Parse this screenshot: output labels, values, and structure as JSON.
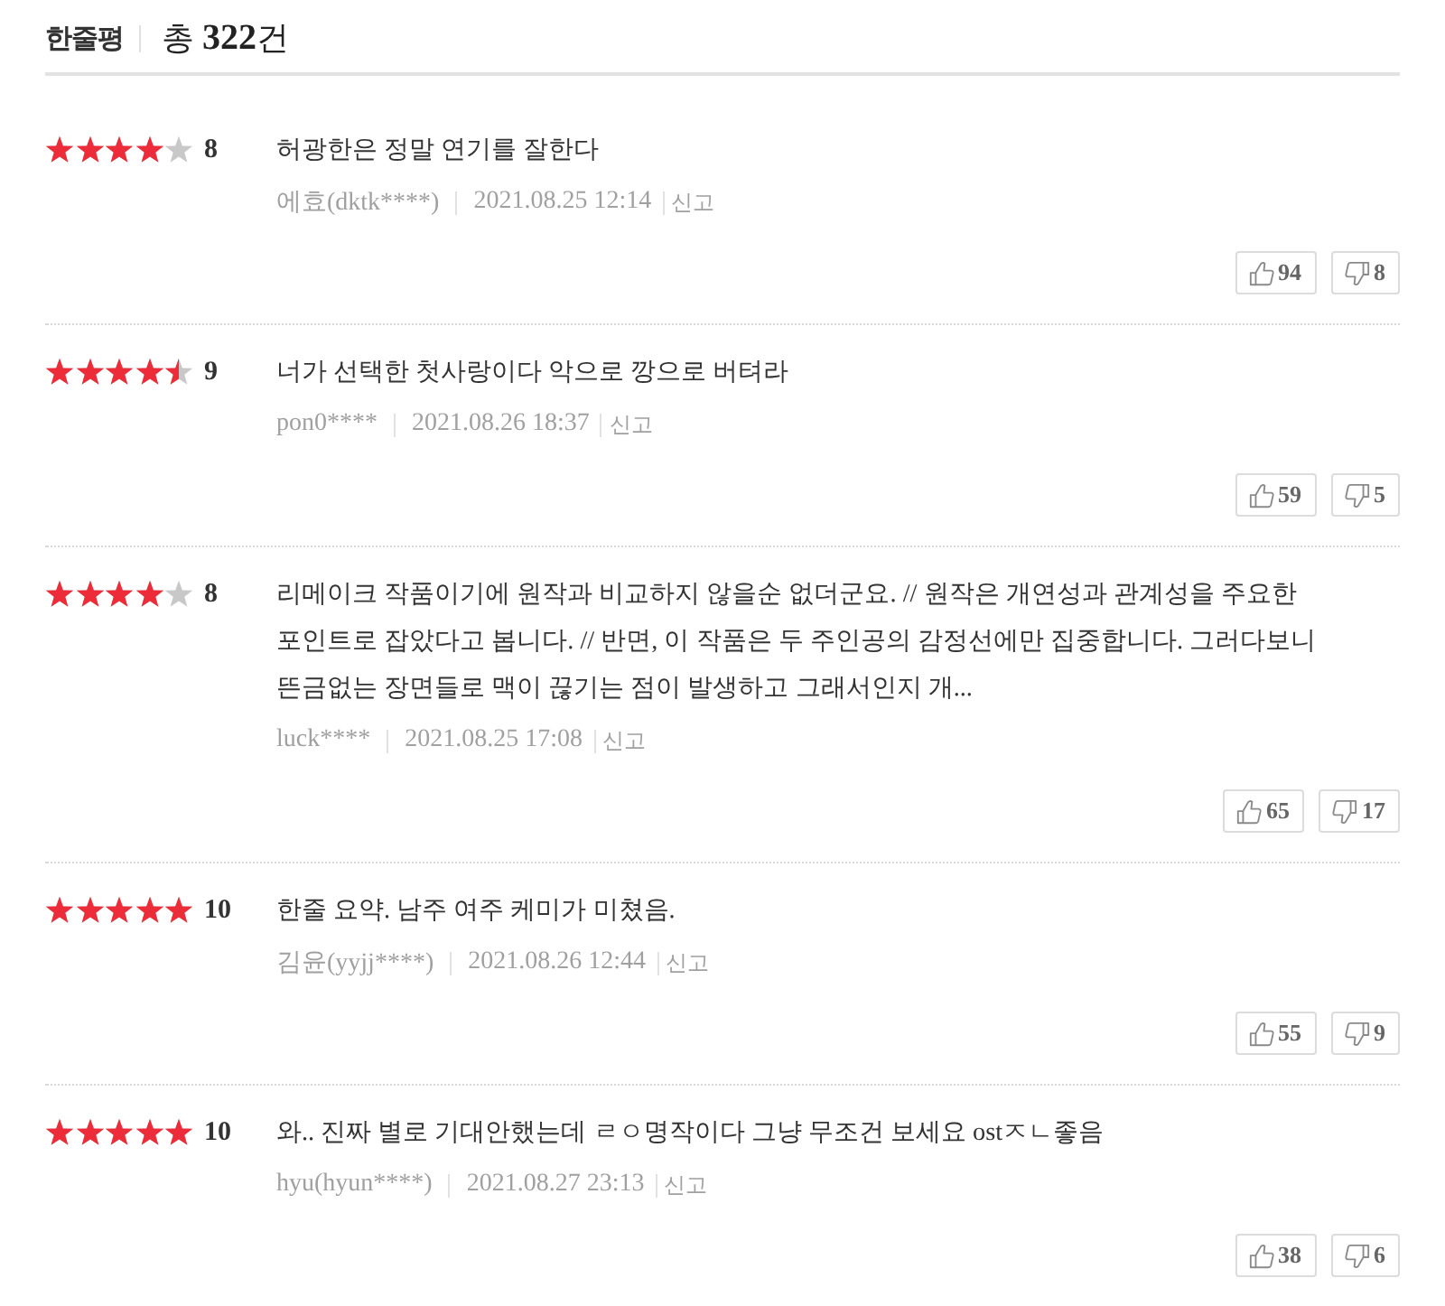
{
  "header": {
    "title": "한줄평",
    "total": "총 **322**건"
  },
  "reviews": [
    {
      "stars": 4,
      "score": "8",
      "text": "허광한은 정말 연기를 잘한다",
      "author": "에효(dktk****)",
      "date": "2021.08.25 12:14",
      "report": "신고",
      "likes": "94",
      "dislikes": "8"
    },
    {
      "stars": 4.5,
      "score": "9",
      "text": "너가 선택한 첫사랑이다 악으로 깡으로 버텨라",
      "author": "pon0****",
      "date": "2021.08.26 18:37",
      "report": "신고",
      "likes": "59",
      "dislikes": "5"
    },
    {
      "stars": 4,
      "score": "8",
      "text": "리메이크 작품이기에 원작과 비교하지 않을순 없더군요. // 원작은 개연성과 관계성을 주요한 포인트로 잡았다고 봅니다. // 반면, 이 작품은 두 주인공의 감정선에만 집중합니다. 그러다보니 뜬금없는 장면들로 맥이 끊기는 점이 발생하고 그래서인지 개...",
      "author": "luck****",
      "date": "2021.08.25 17:08",
      "report": "신고",
      "likes": "65",
      "dislikes": "17"
    },
    {
      "stars": 5,
      "score": "10",
      "text": "한줄 요약. 남주 여주 케미가 미쳤음.",
      "author": "김윤(yyjj****)",
      "date": "2021.08.26 12:44",
      "report": "신고",
      "likes": "55",
      "dislikes": "9"
    },
    {
      "stars": 5,
      "score": "10",
      "text": "와.. 진짜 별로 기대안했는데 ㄹㅇ명작이다 그냥 무조건 보세요 ostㅈㄴ좋음",
      "author": "hyu(hyun****)",
      "date": "2021.08.27 23:13",
      "report": "신고",
      "likes": "38",
      "dislikes": "6"
    }
  ]
}
